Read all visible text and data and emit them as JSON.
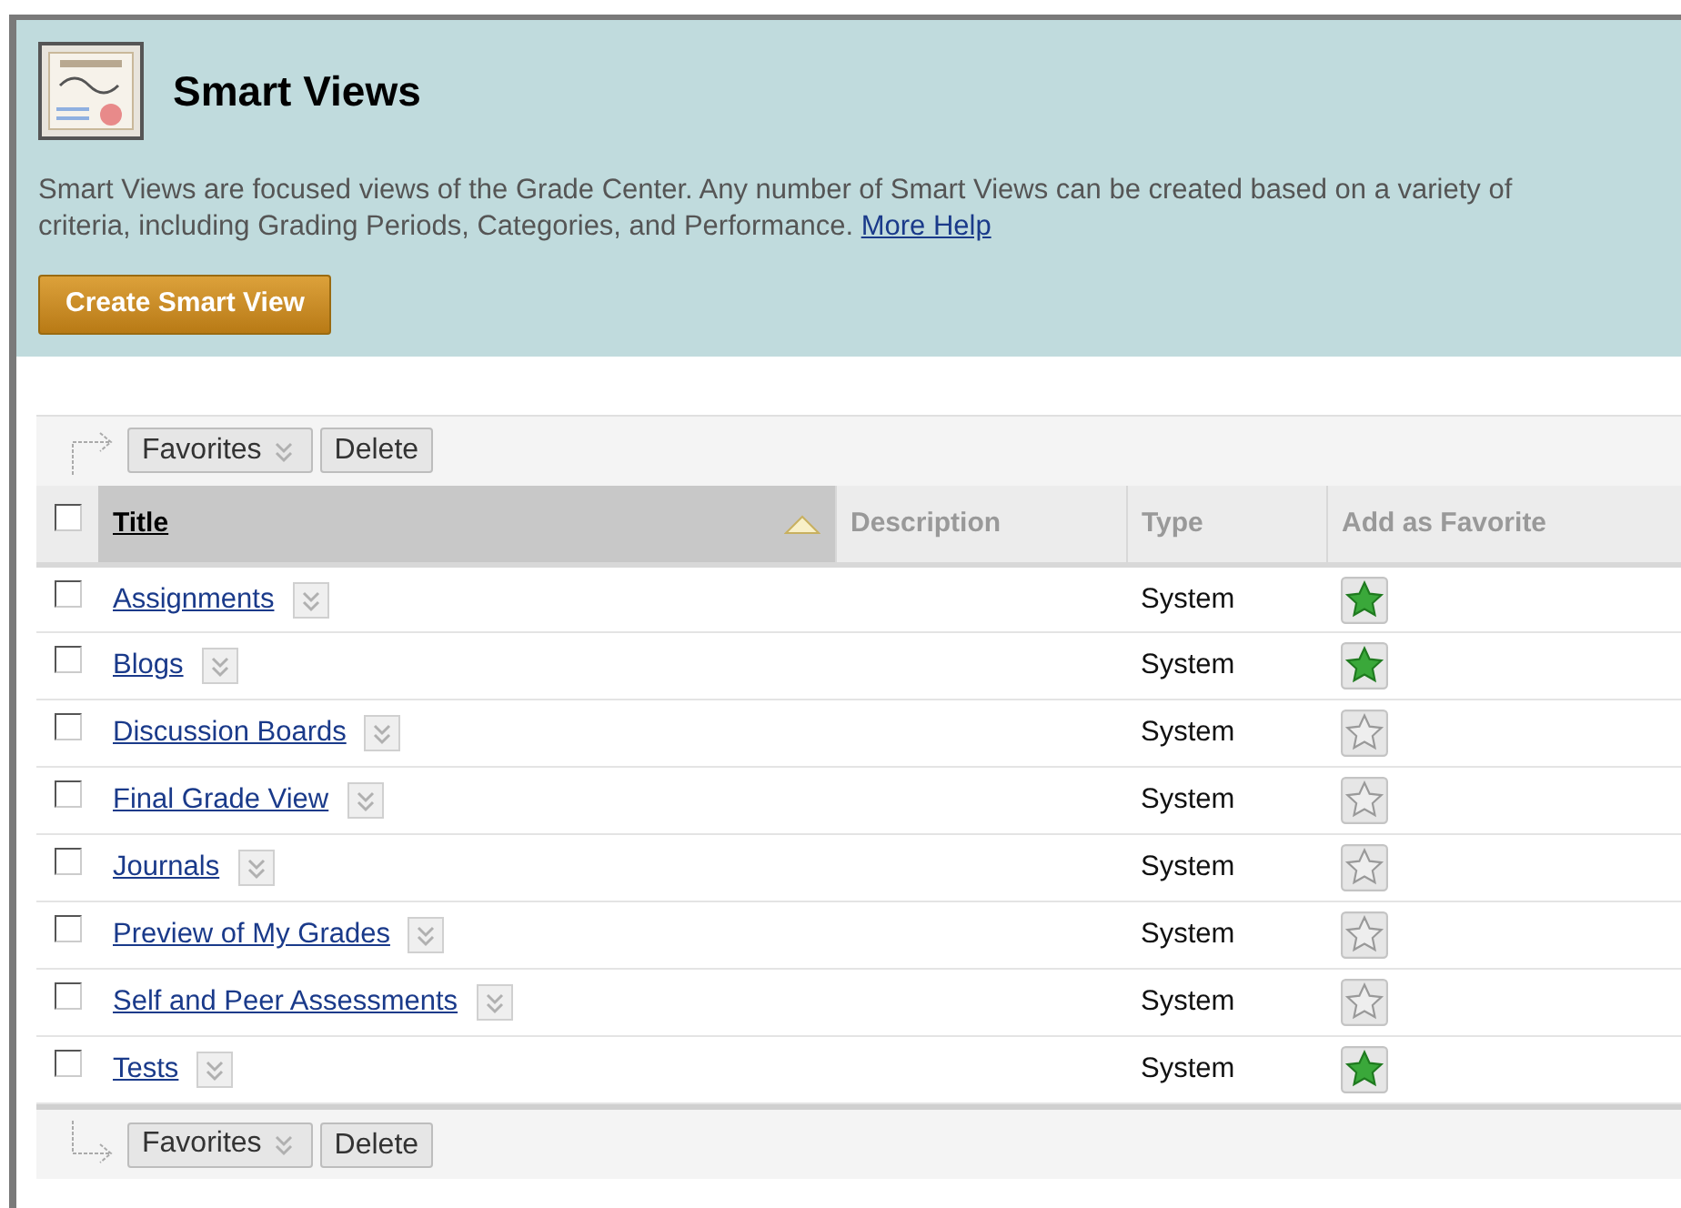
{
  "header": {
    "title": "Smart Views",
    "description": "Smart Views are focused views of the Grade Center. Any number of Smart Views can be created based on a variety of criteria, including Grading Periods, Categories, and Performance.",
    "help_link": "More Help",
    "create_button": "Create Smart View"
  },
  "action_bar_top": {
    "favorites_button": "Favorites",
    "delete_button": "Delete"
  },
  "table": {
    "columns": [
      {
        "label": "Title",
        "sorted": true
      },
      {
        "label": "Description",
        "sorted": false
      },
      {
        "label": "Type",
        "sorted": false
      },
      {
        "label": "Add as Favorite",
        "sorted": false
      }
    ],
    "all_checked": false,
    "rows": [
      {
        "title": "Assignments",
        "type": "System",
        "checked": false,
        "favorite": true
      },
      {
        "title": "Blogs",
        "type": "System",
        "checked": false,
        "favorite": true
      },
      {
        "title": "Discussion Boards",
        "type": "System",
        "checked": false,
        "favorite": false
      },
      {
        "title": "Final Grade View",
        "type": "System",
        "checked": false,
        "favorite": false
      },
      {
        "title": "Journals",
        "type": "System",
        "checked": false,
        "favorite": false
      },
      {
        "title": "Preview of My Grades",
        "type": "System",
        "checked": false,
        "favorite": false
      },
      {
        "title": "Self and Peer Assessments",
        "type": "System",
        "checked": false,
        "favorite": false
      },
      {
        "title": "Tests",
        "type": "System",
        "checked": false,
        "favorite": true
      }
    ]
  },
  "action_bar_bottom": {
    "favorites_button": "Favorites",
    "delete_button": "Delete"
  }
}
